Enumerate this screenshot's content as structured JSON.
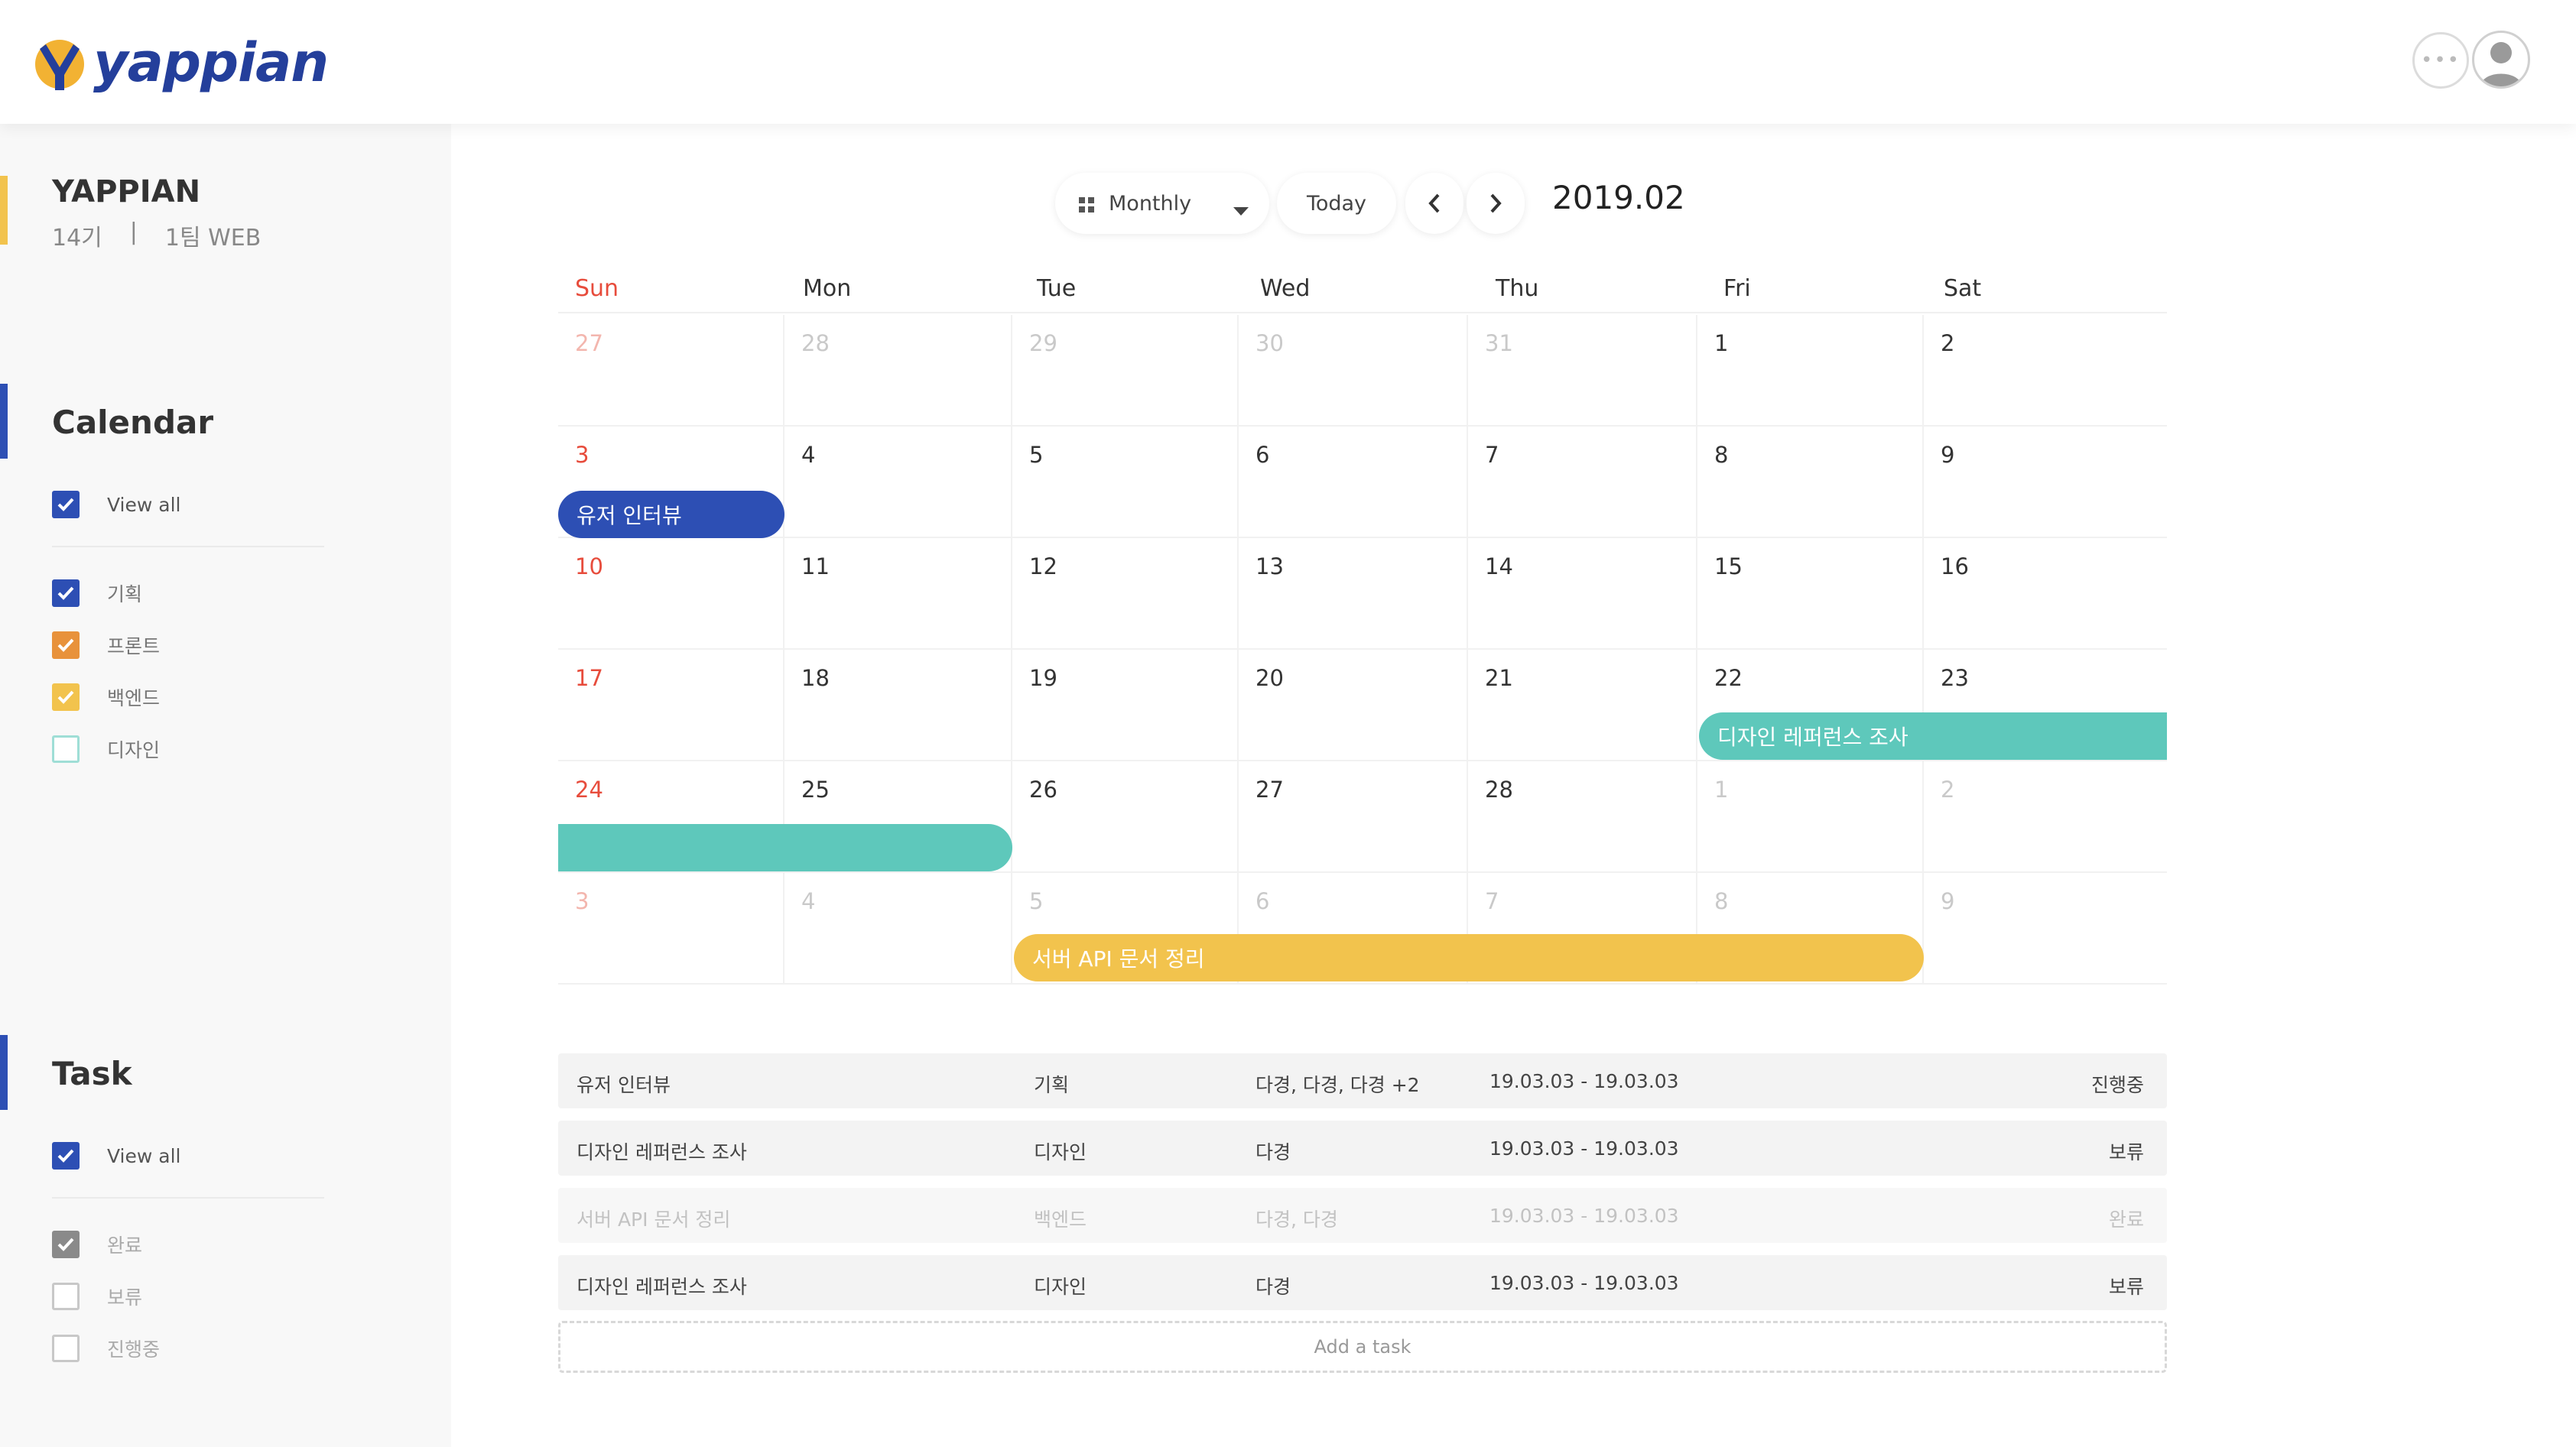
{
  "app": {
    "logo_text": "yappian"
  },
  "header": {
    "more_icon": "more-icon",
    "avatar_icon": "user-avatar-icon"
  },
  "colors": {
    "primary": "#2d4fb4",
    "orange": "#e8923b",
    "yellow": "#f2c34d",
    "teal": "#5ec8bb",
    "sunday": "#e74c3c"
  },
  "sidebar": {
    "team_name": "YAPPIAN",
    "team_gen": "14기",
    "team_div": "|",
    "team_group": "1팀 WEB",
    "calendar": {
      "title": "Calendar",
      "view_all": "View all",
      "filters": [
        {
          "label": "기획",
          "checked": true,
          "color": "#2d4fb4"
        },
        {
          "label": "프론트",
          "checked": true,
          "color": "#e8923b"
        },
        {
          "label": "백엔드",
          "checked": true,
          "color": "#f2c34d"
        },
        {
          "label": "디자인",
          "checked": false,
          "color": "#5ec8bb"
        }
      ]
    },
    "task": {
      "title": "Task",
      "view_all": "View all",
      "filters": [
        {
          "label": "완료",
          "checked": true
        },
        {
          "label": "보류",
          "checked": false
        },
        {
          "label": "진행중",
          "checked": false
        }
      ]
    }
  },
  "toolbar": {
    "view_select": "Monthly",
    "today": "Today",
    "prev_icon": "chevron-left-icon",
    "next_icon": "chevron-right-icon",
    "month": "2019.02"
  },
  "calendar": {
    "weekdays": [
      "Sun",
      "Mon",
      "Tue",
      "Wed",
      "Thu",
      "Fri",
      "Sat"
    ],
    "weeks": [
      [
        "27",
        "28",
        "29",
        "30",
        "31",
        "1",
        "2"
      ],
      [
        "3",
        "4",
        "5",
        "6",
        "7",
        "8",
        "9"
      ],
      [
        "10",
        "11",
        "12",
        "13",
        "14",
        "15",
        "16"
      ],
      [
        "17",
        "18",
        "19",
        "20",
        "21",
        "22",
        "23"
      ],
      [
        "24",
        "25",
        "26",
        "27",
        "28",
        "1",
        "2"
      ],
      [
        "3",
        "4",
        "5",
        "6",
        "7",
        "8",
        "9"
      ]
    ],
    "events": [
      {
        "label": "유저 인터뷰",
        "color": "#2d4fb4"
      },
      {
        "label": "디자인 레퍼런스 조사",
        "color": "#5ec8bb"
      },
      {
        "label": "",
        "color": "#5ec8bb"
      },
      {
        "label": "서버 API 문서 정리",
        "color": "#f2c34d"
      }
    ]
  },
  "tasks": {
    "rows": [
      {
        "title": "유저 인터뷰",
        "category": "기획",
        "members": "다경, 다경, 다경 +2",
        "period": "19.03.03 - 19.03.03",
        "status": "진행중"
      },
      {
        "title": "디자인 레퍼런스 조사",
        "category": "디자인",
        "members": "다경",
        "period": "19.03.03 - 19.03.03",
        "status": "보류"
      },
      {
        "title": "서버 API 문서 정리",
        "category": "백엔드",
        "members": "다경, 다경",
        "period": "19.03.03 - 19.03.03",
        "status": "완료"
      },
      {
        "title": "디자인 레퍼런스 조사",
        "category": "디자인",
        "members": "다경",
        "period": "19.03.03 - 19.03.03",
        "status": "보류"
      }
    ],
    "add_label": "Add a task"
  }
}
